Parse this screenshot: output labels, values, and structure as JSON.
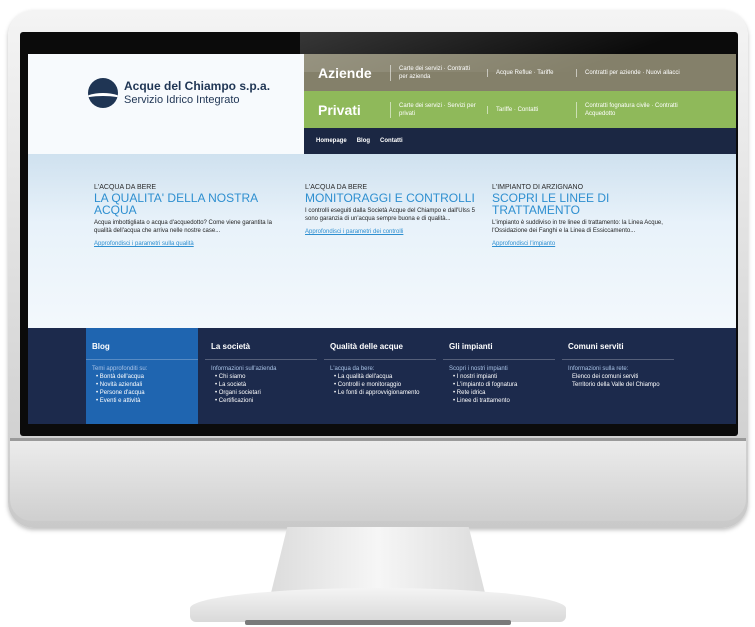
{
  "site": {
    "logo": {
      "name": "Acque del Chiampo s.p.a.",
      "tagline": "Servizio Idrico Integrato"
    },
    "nav": {
      "aziende": {
        "title": "Aziende",
        "col1": "Carte dei servizi · Contratti per azienda",
        "col2": "Acque Reflue · Tariffe",
        "col3": "Contratti per aziende · Nuovi allacci"
      },
      "privati": {
        "title": "Privati",
        "col1": "Carte dei servizi · Servizi per privati",
        "col2": "Tariffe · Contatti",
        "col3": "Contratti fognatura civile · Contratti Acquedotto"
      }
    },
    "subnav": [
      "Homepage",
      "Blog",
      "Contatti"
    ],
    "hero": [
      {
        "kicker": "L'ACQUA DA BERE",
        "title": "LA QUALITA' DELLA NOSTRA ACQUA",
        "body": "Acqua imbottigliata o acqua d'acquedotto? Come viene garantita la qualità dell'acqua che arriva nelle nostre case...",
        "link": "Approfondisci i parametri sulla qualità"
      },
      {
        "kicker": "L'ACQUA DA BERE",
        "title": "MONITORAGGI E CONTROLLI",
        "body": "I controlli eseguiti dalla Società Acque del Chiampo e dall'Ulss 5 sono garanzia di un'acqua sempre buona e di qualità...",
        "link": "Approfondisci i parametri dei controlli"
      },
      {
        "kicker": "L'IMPIANTO DI ARZIGNANO",
        "title": "SCOPRI LE LINEE DI TRATTAMENTO",
        "body": "L'impianto è suddiviso in tre linee di trattamento: la Linea Acque, l'Ossidazione dei Fanghi e la Linea di Essiccamento...",
        "link": "Approfondisci l'impianto"
      }
    ],
    "footer": [
      {
        "head": "Blog",
        "intro": "Temi approfonditi su:",
        "items": [
          "• Bontà dell'acqua",
          "• Novità aziendali",
          "• Persone d'acqua",
          "• Eventi e attività"
        ]
      },
      {
        "head": "La società",
        "intro": "Informazioni sull'azienda",
        "items": [
          "• Chi siamo",
          "• La società",
          "• Organi societari",
          "• Certificazioni"
        ]
      },
      {
        "head": "Qualità delle acque",
        "intro": "L'acqua da bere:",
        "items": [
          "• La qualità dell'acqua",
          "• Controlli e monitoraggio",
          "• Le fonti di approvvigionamento"
        ]
      },
      {
        "head": "Gli impianti",
        "intro": "Scopri i nostri impianti",
        "items": [
          "• I nostri impianti",
          "• L'impianto di fognatura",
          "• Rete idrica",
          "• Linee di trattamento"
        ]
      },
      {
        "head": "Comuni serviti",
        "intro": "Informazioni sulla rete:",
        "items": [
          "Elenco dei comuni serviti",
          "Territorio della Valle del Chiampo"
        ]
      }
    ]
  }
}
